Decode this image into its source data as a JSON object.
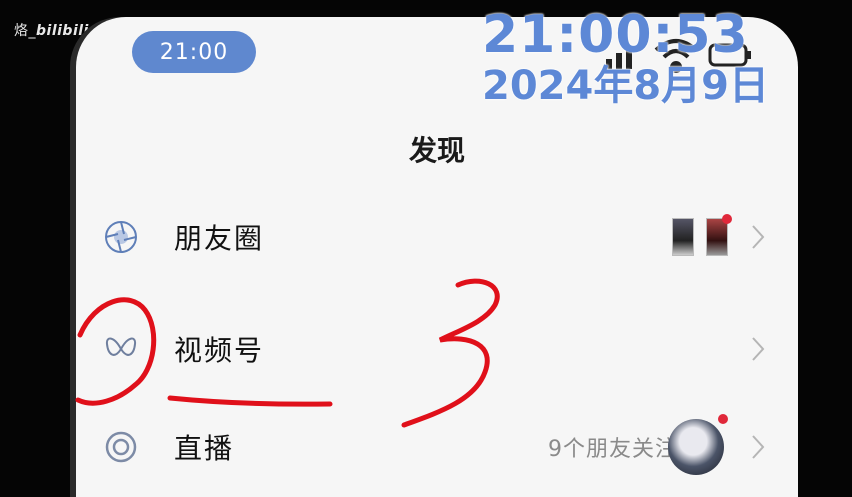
{
  "watermark": {
    "prefix": "烙_",
    "brand": "bilibili"
  },
  "status_bar": {
    "time": "21:00"
  },
  "overlay": {
    "clock": "21:00:53",
    "date": "2024年8月9日"
  },
  "page": {
    "title": "发现"
  },
  "menu": {
    "items": [
      {
        "label": "朋友圈",
        "icon": "moments-aperture-icon"
      },
      {
        "label": "视频号",
        "icon": "channels-butterfly-icon"
      },
      {
        "label": "直播",
        "icon": "live-ring-icon",
        "right_text": "9个朋友关注"
      }
    ]
  },
  "annotation": {
    "number": "3"
  },
  "colors": {
    "accent": "#5f88cf",
    "badge": "#e0283a",
    "scribble": "#e0101a"
  }
}
